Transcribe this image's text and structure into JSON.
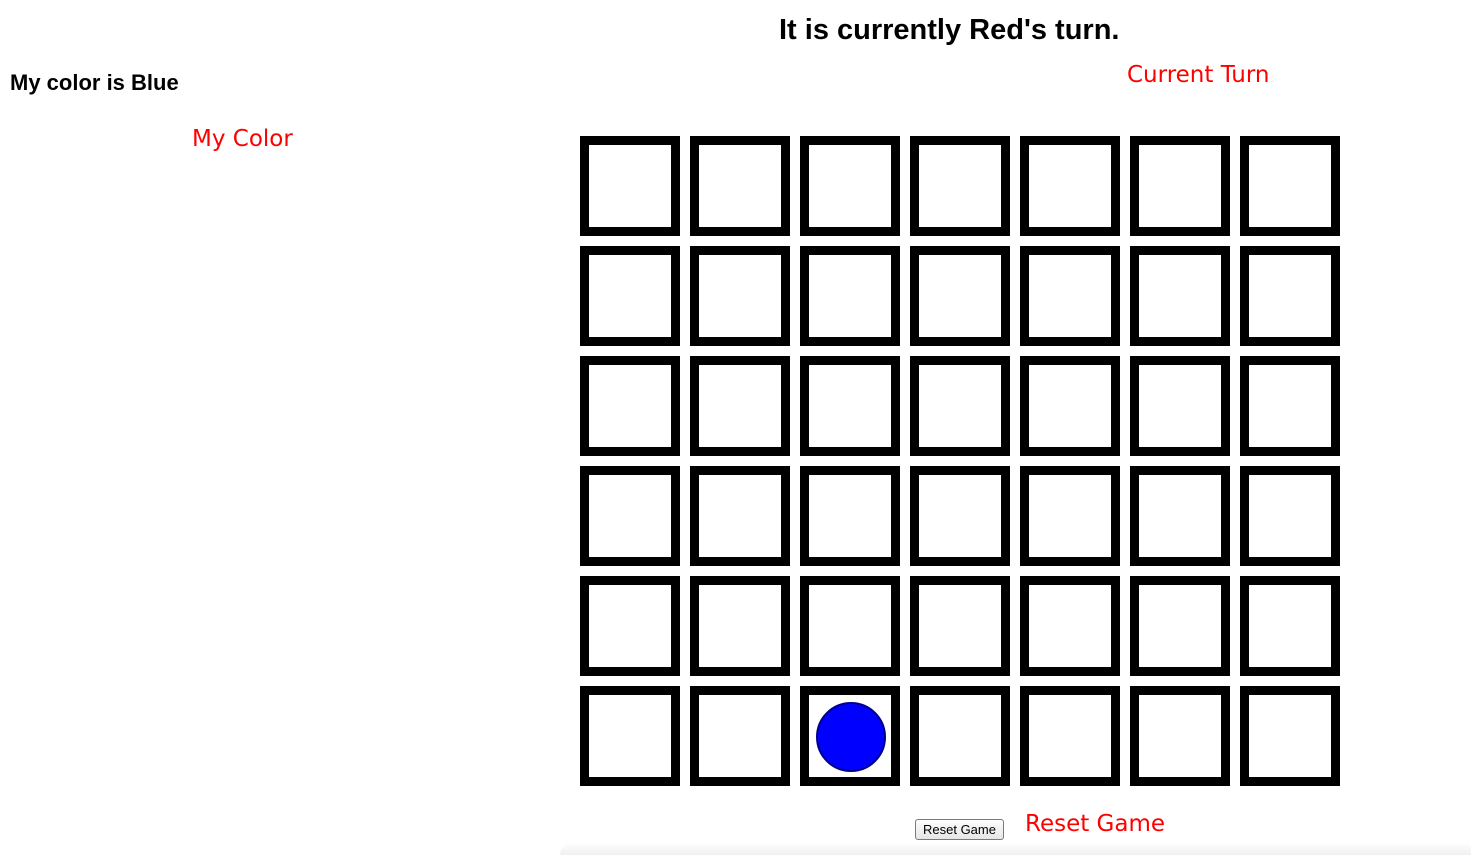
{
  "status": {
    "turn_text": "It is currently Red's turn.",
    "my_color_text": "My color is Blue"
  },
  "annotations": {
    "color": "#ff0000",
    "current_turn": "Current Turn",
    "my_color": "My Color",
    "reset_game": "Reset Game"
  },
  "board": {
    "columns": 7,
    "rows": 6,
    "cell_border_color": "#000000",
    "pieces": [
      {
        "row": 5,
        "col": 2,
        "color": "blue",
        "fill": "#0000ff"
      }
    ]
  },
  "controls": {
    "reset_label": "Reset Game"
  }
}
